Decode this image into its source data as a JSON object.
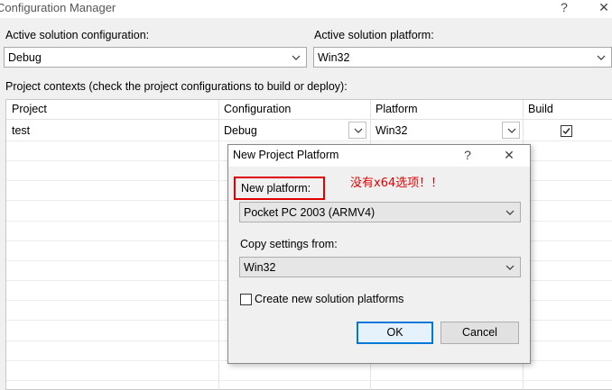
{
  "window": {
    "title": "Configuration Manager",
    "help_label": "?",
    "close_label": "✕"
  },
  "active_config": {
    "label": "Active solution configuration:",
    "value": "Debug"
  },
  "active_platform": {
    "label": "Active solution platform:",
    "value": "Win32"
  },
  "contexts_label": "Project contexts (check the project configurations to build or deploy):",
  "grid": {
    "headers": [
      "Project",
      "Configuration",
      "Platform",
      "Build"
    ],
    "row": {
      "project": "test",
      "configuration": "Debug",
      "platform": "Win32",
      "build_checked": true
    }
  },
  "dialog": {
    "title": "New Project Platform",
    "help_label": "?",
    "close_label": "✕",
    "new_platform_label": "New platform:",
    "new_platform_value": "Pocket PC 2003 (ARMV4)",
    "copy_label": "Copy settings from:",
    "copy_value": "Win32",
    "create_label": "Create new solution platforms",
    "create_checked": false,
    "ok_label": "OK",
    "cancel_label": "Cancel"
  },
  "annotation": "没有x64选项！！",
  "colors": {
    "annotation": "#e00000",
    "default_button_border": "#0078d7"
  }
}
